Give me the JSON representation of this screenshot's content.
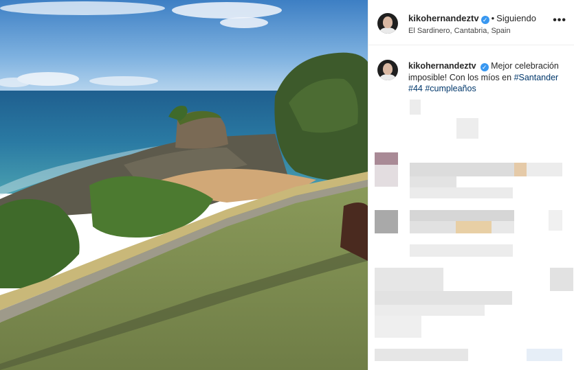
{
  "post": {
    "username": "kikohernandeztv",
    "verified_glyph": "✓",
    "separator": "•",
    "follow_status": "Siguiendo",
    "location": "El Sardinero, Cantabria, Spain",
    "more_glyph": "•••"
  },
  "caption": {
    "username": "kikohernandeztv",
    "text": "Mejor celebración imposible! Con los míos en",
    "hashtags": [
      "#Santander",
      "#44",
      "#cumpleaños"
    ]
  },
  "icons": {
    "verified": "verified-badge-icon",
    "more": "more-options-icon"
  },
  "colors": {
    "verified_blue": "#3897f0",
    "hashtag_link": "#00376b",
    "border": "#efefef"
  }
}
